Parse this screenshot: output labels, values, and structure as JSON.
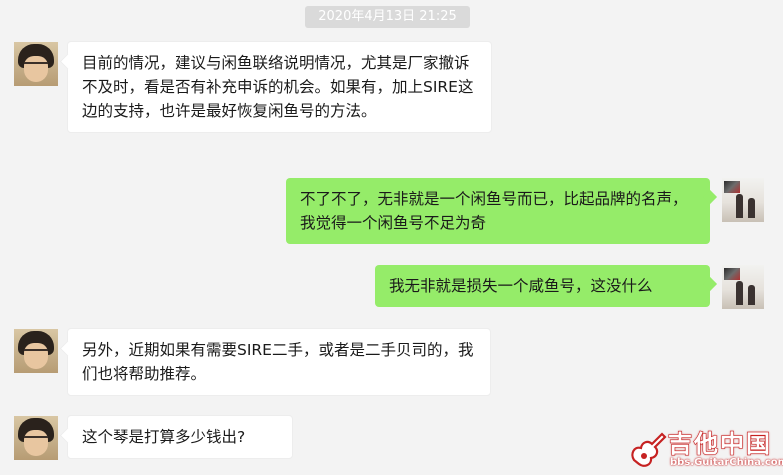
{
  "timestamp": "2020年4月13日 21:25",
  "messages": [
    {
      "side": "in",
      "text": "目前的情况，建议与闲鱼联络说明情况，尤其是厂家撤诉不及时，看是否有补充申诉的机会。如果有，加上SIRE这边的支持，也许是最好恢复闲鱼号的方法。"
    },
    {
      "side": "out",
      "text": "不了不了，无非就是一个闲鱼号而已，比起品牌的名声，我觉得一个闲鱼号不足为奇"
    },
    {
      "side": "out",
      "text": "我无非就是损失一个咸鱼号，这没什么"
    },
    {
      "side": "in",
      "text": "另外，近期如果有需要SIRE二手，或者是二手贝司的，我们也将帮助推荐。"
    },
    {
      "side": "in",
      "text": "这个琴是打算多少钱出?"
    }
  ],
  "watermark": {
    "title": "吉他中国",
    "url": "bbs.GuitarChina.com"
  },
  "colors": {
    "background": "#f3f3f3",
    "outgoing_bubble": "#95ec69",
    "incoming_bubble": "#ffffff",
    "timestamp_bg": "#dadada",
    "watermark_red": "#c62222"
  }
}
